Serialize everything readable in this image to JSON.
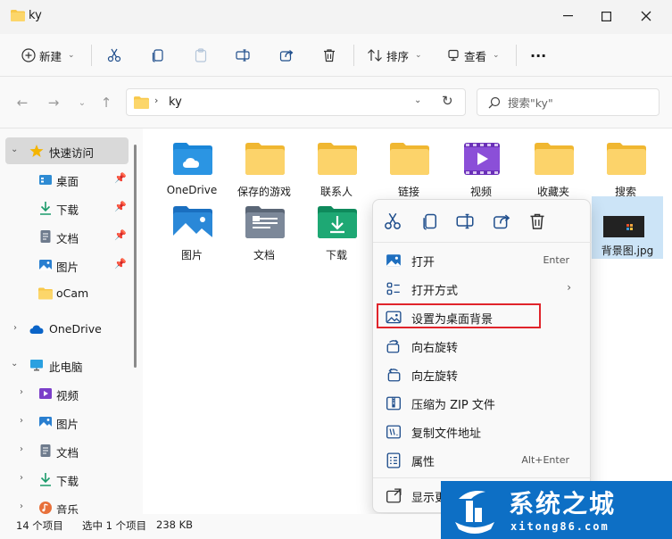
{
  "window": {
    "title": "ky",
    "min_icon": "minimize-icon",
    "max_icon": "maximize-icon",
    "close_icon": "close-icon"
  },
  "toolbar": {
    "new_label": "新建",
    "sort_label": "排序",
    "view_label": "查看",
    "more_label": "···"
  },
  "nav": {
    "crumb": "ky",
    "search_placeholder": "搜索\"ky\""
  },
  "sidebar": {
    "items": [
      {
        "label": "快速访问"
      },
      {
        "label": "桌面"
      },
      {
        "label": "下载"
      },
      {
        "label": "文档"
      },
      {
        "label": "图片"
      },
      {
        "label": "oCam"
      },
      {
        "label": "OneDrive"
      },
      {
        "label": "此电脑"
      },
      {
        "label": "视频"
      },
      {
        "label": "图片"
      },
      {
        "label": "文档"
      },
      {
        "label": "下载"
      },
      {
        "label": "音乐"
      }
    ]
  },
  "files": [
    {
      "name": "OneDrive"
    },
    {
      "name": "保存的游戏"
    },
    {
      "name": "联系人"
    },
    {
      "name": "链接"
    },
    {
      "name": "视频"
    },
    {
      "name": "收藏夹"
    },
    {
      "name": "搜索"
    },
    {
      "name": "图片"
    },
    {
      "name": "文档"
    },
    {
      "name": "下载"
    },
    {
      "name": "背景图.jpg"
    }
  ],
  "context_menu": {
    "items": [
      {
        "label": "打开",
        "shortcut": "Enter"
      },
      {
        "label": "打开方式"
      },
      {
        "label": "设置为桌面背景"
      },
      {
        "label": "向右旋转"
      },
      {
        "label": "向左旋转"
      },
      {
        "label": "压缩为 ZIP 文件"
      },
      {
        "label": "复制文件地址"
      },
      {
        "label": "属性",
        "shortcut": "Alt+Enter"
      },
      {
        "label": "显示更"
      }
    ]
  },
  "status": {
    "count": "14 个项目",
    "selection": "选中 1 个项目",
    "size": "238 KB"
  },
  "watermark": {
    "text": "系统之城",
    "url": "xitong86.com"
  },
  "colors": {
    "folder": "#f8c84a",
    "accent": "#0067c0",
    "highlight_border": "#e0242b",
    "watermark_bg": "#0d6fc5"
  }
}
